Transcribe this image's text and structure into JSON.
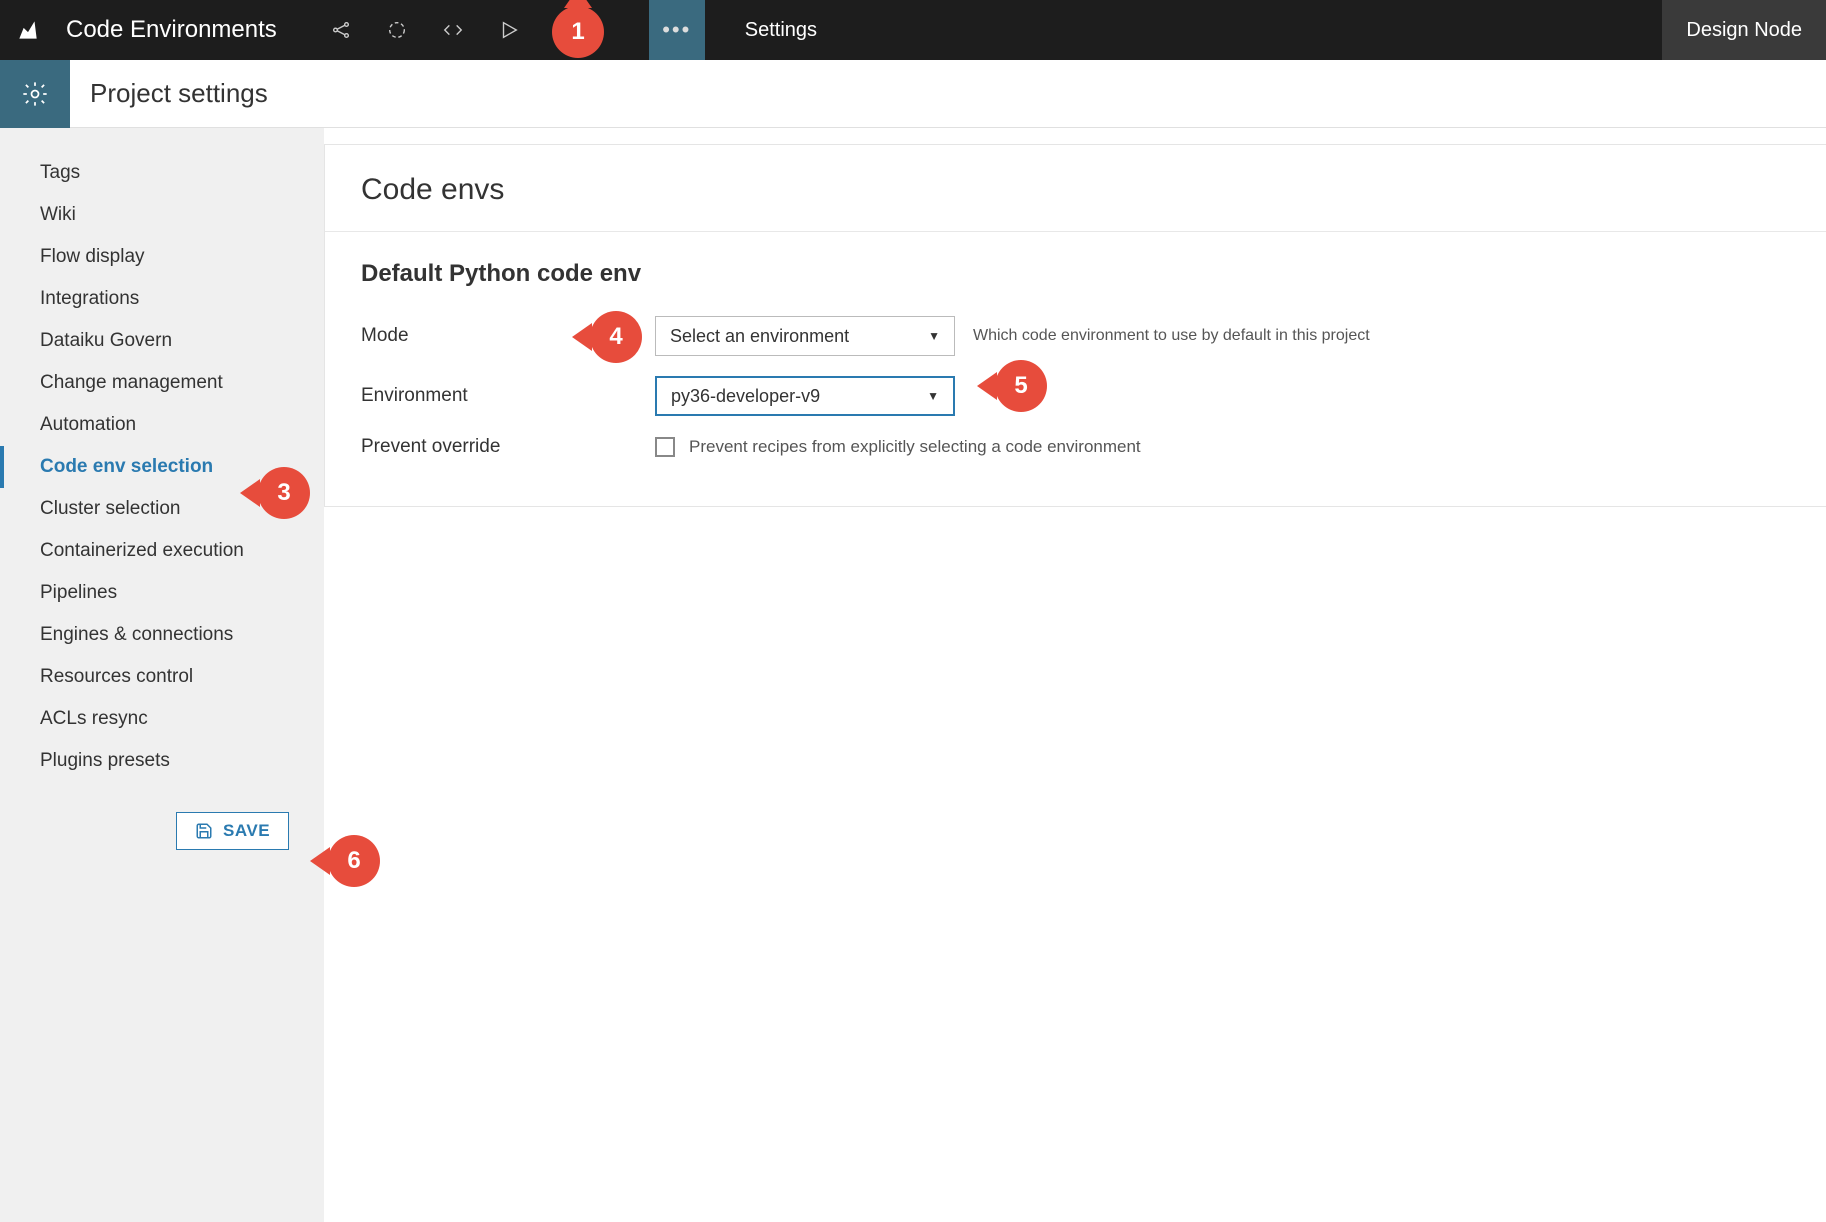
{
  "topbar": {
    "project_title": "Code Environments",
    "tab_label": "Settings",
    "node_label": "Design Node"
  },
  "page_header": {
    "title": "Project settings"
  },
  "sidebar": {
    "items": [
      {
        "label": "Tags",
        "active": false
      },
      {
        "label": "Wiki",
        "active": false
      },
      {
        "label": "Flow display",
        "active": false
      },
      {
        "label": "Integrations",
        "active": false
      },
      {
        "label": "Dataiku Govern",
        "active": false
      },
      {
        "label": "Change management",
        "active": false
      },
      {
        "label": "Automation",
        "active": false
      },
      {
        "label": "Code env selection",
        "active": true
      },
      {
        "label": "Cluster selection",
        "active": false
      },
      {
        "label": "Containerized execution",
        "active": false
      },
      {
        "label": "Pipelines",
        "active": false
      },
      {
        "label": "Engines & connections",
        "active": false
      },
      {
        "label": "Resources control",
        "active": false
      },
      {
        "label": "ACLs resync",
        "active": false
      },
      {
        "label": "Plugins presets",
        "active": false
      }
    ],
    "save_label": "SAVE"
  },
  "content": {
    "panel_title": "Code envs",
    "section_title": "Default Python code env",
    "mode": {
      "label": "Mode",
      "value": "Select an environment",
      "help": "Which code environment to use by default in this project"
    },
    "environment": {
      "label": "Environment",
      "value": "py36-developer-v9"
    },
    "prevent": {
      "label": "Prevent override",
      "checkbox_label": "Prevent recipes from explicitly selecting a code environment"
    }
  },
  "callouts": {
    "c1": "1",
    "c3": "3",
    "c4": "4",
    "c5": "5",
    "c6": "6"
  }
}
